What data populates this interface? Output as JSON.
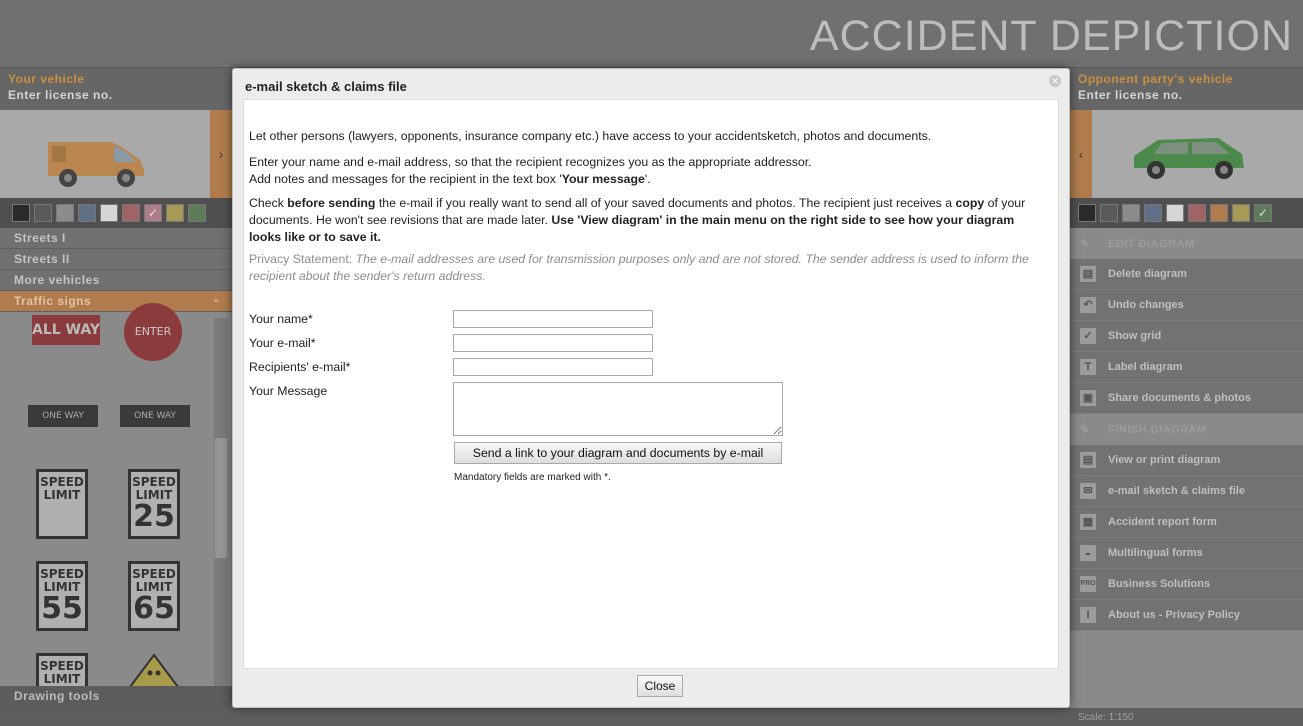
{
  "app": {
    "title": "ACCIDENT  DEPICTION"
  },
  "left_panel": {
    "vehicle_label": "Your vehicle",
    "license_placeholder": "Enter license no.",
    "arrow": "›",
    "swatch_colors": [
      "#2a2a2a",
      "#5a5a5a",
      "#8c8c8c",
      "#5e6f86",
      "#d6d6d6",
      "#a06464",
      "#b07c8a",
      "#a69a55",
      "#5d7a5a"
    ],
    "menu": [
      {
        "label": "Streets I"
      },
      {
        "label": "Streets II"
      },
      {
        "label": "More vehicles"
      },
      {
        "label": "Traffic signs"
      }
    ],
    "signs": {
      "all_way": "ALL WAY",
      "enter": "ENTER",
      "one_way_left": "ONE WAY",
      "one_way_right": "ONE WAY",
      "speed": "SPEED",
      "limit": "LIMIT",
      "speed_values": [
        "25",
        "55",
        "65"
      ]
    },
    "drawing_tools": "Drawing tools"
  },
  "right_panel": {
    "vehicle_label": "Opponent party's vehicle",
    "license_placeholder": "Enter license no.",
    "arrow": "‹",
    "edit_section": "EDIT DIAGRAM",
    "edit_items": [
      {
        "label": "Delete diagram",
        "icon": "trash-icon"
      },
      {
        "label": "Undo changes",
        "icon": "undo-icon"
      },
      {
        "label": "Show grid",
        "icon": "grid-check-icon"
      },
      {
        "label": "Label diagram",
        "icon": "text-icon"
      },
      {
        "label": "Share documents & photos",
        "icon": "share-icon"
      }
    ],
    "finish_section": "FINISH DIAGRAM",
    "finish_items": [
      {
        "label": "View or print diagram",
        "icon": "document-icon"
      },
      {
        "label": "e-mail sketch & claims file",
        "icon": "mail-icon"
      },
      {
        "label": "Accident report form",
        "icon": "form-icon"
      },
      {
        "label": "Multilingual forms",
        "icon": "globe-icon"
      },
      {
        "label": "Business Solutions",
        "icon": "pro-icon"
      },
      {
        "label": "About us - Privacy Policy",
        "icon": "info-icon"
      }
    ]
  },
  "bottom": {
    "scale": "Scale: 1:150"
  },
  "modal": {
    "title": "e-mail sketch & claims file",
    "intro": "Let other persons (lawyers, opponents, insurance company etc.) have access to your accidentsketch, photos and documents.",
    "line2": "Enter your name and e-mail address, so that the recipient recognizes you as the appropriate addressor.",
    "line3_pre": "Add notes and messages for the recipient in the text box '",
    "line3_bold": "Your message",
    "line3_post": "'.",
    "check_pre": "Check ",
    "check_bold1": "before sending",
    "check_mid": " the e-mail if you really want to send all of your saved documents and photos. The recipient just receives a ",
    "check_bold2": "copy",
    "check_mid2": " of your documents. He won't see revisions that are made later. ",
    "check_bold3": "Use 'View diagram' in the main menu on the right side to see how your diagram looks like or to save it.",
    "privacy_label": "Privacy Statement: ",
    "privacy_text": "The e-mail addresses are used for transmission purposes only and are not stored. The sender address is used to inform the recipient about the sender's return address.",
    "form": {
      "name_label": "Your name*",
      "name_value": "",
      "email_label": "Your e-mail*",
      "email_value": "",
      "recipients_label": "Recipients' e-mail*",
      "recipients_value": "",
      "message_label": "Your Message",
      "message_value": "",
      "send_button": "Send a link to your diagram and documents by e-mail",
      "mandatory_note": "Mandatory fields are marked with *."
    },
    "close_button": "Close"
  }
}
